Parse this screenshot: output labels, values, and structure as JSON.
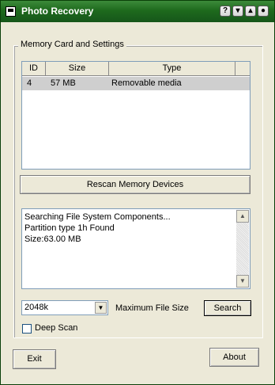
{
  "window": {
    "title": "Photo Recovery"
  },
  "titlebar": {
    "buttons": [
      "?",
      "▾",
      "▴",
      "●"
    ]
  },
  "group": {
    "label": "Memory Card and Settings"
  },
  "table": {
    "columns": [
      "ID",
      "Size",
      "Type"
    ],
    "rows": [
      [
        "4",
        "57 MB",
        "Removable media"
      ]
    ]
  },
  "buttons": {
    "rescan": "Rescan Memory Devices",
    "search": "Search",
    "exit": "Exit",
    "about": "About"
  },
  "log": {
    "lines": [
      "Searching File System Components...",
      "Partition type  1h Found",
      "Size:63.00 MB"
    ]
  },
  "settings": {
    "max_size_value": "2048k",
    "max_size_label": "Maximum File Size",
    "deep_scan_label": "Deep Scan",
    "deep_scan_checked": false
  }
}
